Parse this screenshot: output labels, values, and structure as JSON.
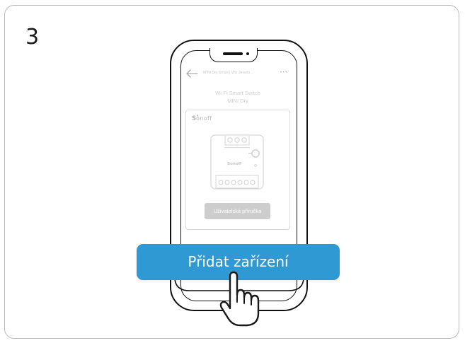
{
  "step": {
    "number": "3"
  },
  "app": {
    "topbar_title": "MINI Dry Smart | Wiz Jevwfo…",
    "more_icon": "⋯",
    "device_title_line1": "Wi-Fi Smart Switch",
    "device_title_line2": "MINI Dry",
    "brand_logo": "Sonoff",
    "manual_button_label": "Uživatelská příručka"
  },
  "overlay": {
    "add_device_label": "Přidat zařízení"
  },
  "colors": {
    "accent": "#2f99d4",
    "manual_button": "#cdcdcd",
    "frame": "#b9b9b9"
  },
  "icons": [
    "back-arrow-icon",
    "more-icon",
    "hand-pointer-icon"
  ]
}
